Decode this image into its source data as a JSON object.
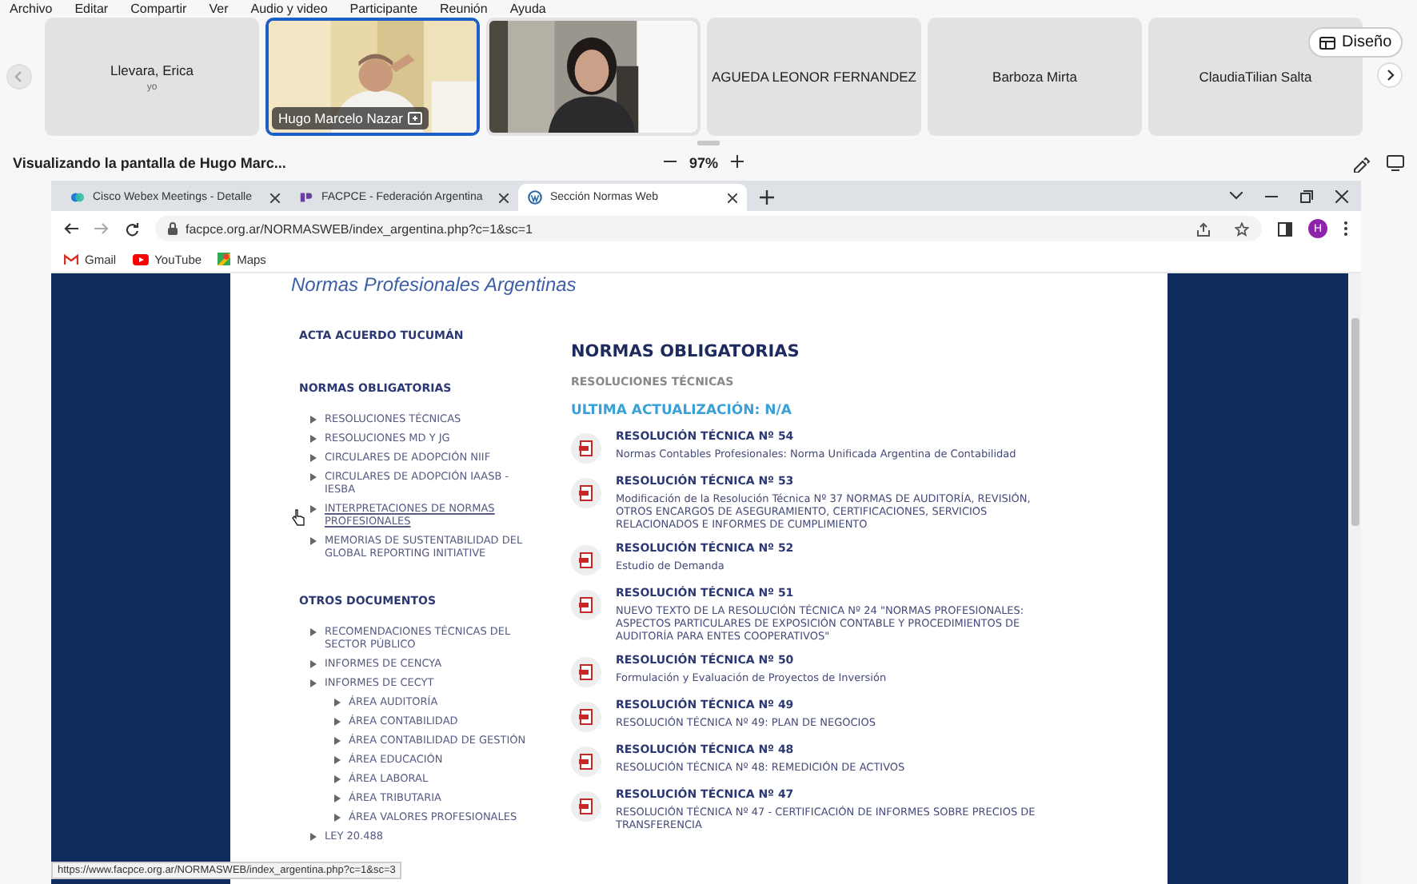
{
  "menu_bar": [
    "Archivo",
    "Editar",
    "Compartir",
    "Ver",
    "Audio y video",
    "Participante",
    "Reunión",
    "Ayuda"
  ],
  "participants": [
    {
      "kind": "placeholder",
      "name": "Llevara, Erica",
      "subtitle": "yo",
      "selected": false
    },
    {
      "kind": "video",
      "name": "Hugo Marcelo Nazar",
      "selected": true
    },
    {
      "kind": "video",
      "selected": false
    },
    {
      "kind": "placeholder",
      "name": "AGUEDA LEONOR FERNANDEZ",
      "selected": false
    },
    {
      "kind": "placeholder",
      "name": "Barboza Mirta",
      "selected": false
    },
    {
      "kind": "placeholder",
      "name": "ClaudiaTilian Salta",
      "selected": false
    }
  ],
  "layout_button": {
    "label": "Diseño"
  },
  "share_bar": {
    "title": "Visualizando la pantalla de Hugo Marc...",
    "zoom": "97%"
  },
  "browser": {
    "tabs": [
      {
        "title": "Cisco Webex Meetings - Detalle",
        "selected": false,
        "kind": "webex"
      },
      {
        "title": "FACPCE - Federación Argentina",
        "selected": false,
        "kind": "facpce"
      },
      {
        "title": "Sección Normas Web",
        "selected": true,
        "kind": "wordpress"
      }
    ],
    "url": "facpce.org.ar/NORMASWEB/index_argentina.php?c=1&sc=1",
    "profile_initial": "H",
    "bookmarks": [
      {
        "label": "Gmail",
        "kind": "gmail"
      },
      {
        "label": "YouTube",
        "kind": "youtube"
      },
      {
        "label": "Maps",
        "kind": "maps"
      }
    ],
    "status_url": "https://www.facpce.org.ar/NORMASWEB/index_argentina.php?c=1&sc=3"
  },
  "page": {
    "banner": "Normas Profesionales Argentinas",
    "sidebar": [
      {
        "heading": "ACTA ACUERDO TUCUMÁN"
      },
      {
        "heading": "NORMAS OBLIGATORIAS",
        "items": [
          {
            "label": "RESOLUCIONES TÉCNICAS",
            "hovered": false
          },
          {
            "label": "RESOLUCIONES MD Y JG",
            "hovered": false
          },
          {
            "label": "CIRCULARES DE ADOPCIÓN NIIF",
            "hovered": false
          },
          {
            "label": "CIRCULARES DE ADOPCIÓN IAASB - IESBA",
            "hovered": false
          },
          {
            "label": "INTERPRETACIONES DE NORMAS PROFESIONALES",
            "hovered": true
          },
          {
            "label": "MEMORIAS DE SUSTENTABILIDAD DEL GLOBAL REPORTING INITIATIVE",
            "hovered": false
          }
        ]
      },
      {
        "heading": "OTROS DOCUMENTOS",
        "items": [
          {
            "label": "RECOMENDACIONES TÉCNICAS DEL SECTOR PÚBLICO",
            "hovered": false
          },
          {
            "label": "INFORMES DE CENCYA",
            "hovered": false
          },
          {
            "label": "INFORMES DE CECYT",
            "hovered": false,
            "children": [
              {
                "label": "ÁREA AUDITORÍA",
                "hovered": false
              },
              {
                "label": "ÁREA CONTABILIDAD",
                "hovered": false
              },
              {
                "label": "ÁREA CONTABILIDAD DE GESTIÓN",
                "hovered": false
              },
              {
                "label": "ÁREA EDUCACIÓN",
                "hovered": false
              },
              {
                "label": "ÁREA LABORAL",
                "hovered": false
              },
              {
                "label": "ÁREA TRIBUTARIA",
                "hovered": false
              },
              {
                "label": "ÁREA VALORES PROFESIONALES",
                "hovered": false
              }
            ]
          },
          {
            "label": "LEY 20.488",
            "hovered": false
          }
        ]
      }
    ],
    "content": {
      "title": "NORMAS OBLIGATORIAS",
      "subtitle": "RESOLUCIONES TÉCNICAS",
      "updated": "ULTIMA ACTUALIZACIÓN: N/A",
      "resolutions": [
        {
          "title": "RESOLUCIÓN TÉCNICA Nº 54",
          "description": "Normas Contables Profesionales: Norma Unificada Argentina de Contabilidad"
        },
        {
          "title": "RESOLUCIÓN TÉCNICA Nº 53",
          "description": "Modificación de la Resolución Técnica Nº 37 NORMAS DE AUDITORÍA, REVISIÓN, OTROS ENCARGOS DE ASEGURAMIENTO, CERTIFICACIONES, SERVICIOS RELACIONADOS E INFORMES DE CUMPLIMIENTO"
        },
        {
          "title": "RESOLUCIÓN TÉCNICA Nº 52",
          "description": "Estudio de Demanda"
        },
        {
          "title": "RESOLUCIÓN TÉCNICA Nº 51",
          "description": "NUEVO TEXTO DE LA RESOLUCIÓN TÉCNICA Nº 24 \"NORMAS PROFESIONALES: ASPECTOS PARTICULARES DE EXPOSICIÓN CONTABLE Y PROCEDIMIENTOS DE AUDITORÍA PARA ENTES COOPERATIVOS\""
        },
        {
          "title": "RESOLUCIÓN TÉCNICA Nº 50",
          "description": "Formulación y Evaluación de Proyectos de Inversión"
        },
        {
          "title": "RESOLUCIÓN TÉCNICA Nº 49",
          "description": "RESOLUCIÓN TÉCNICA Nº 49: PLAN DE NEGOCIOS"
        },
        {
          "title": "RESOLUCIÓN TÉCNICA Nº 48",
          "description": "RESOLUCIÓN TÉCNICA Nº 48: REMEDICIÓN DE ACTIVOS"
        },
        {
          "title": "RESOLUCIÓN TÉCNICA Nº 47",
          "description": "RESOLUCIÓN TÉCNICA Nº 47 - CERTIFICACIÓN DE INFORMES SOBRE PRECIOS DE TRANSFERENCIA"
        }
      ]
    }
  }
}
